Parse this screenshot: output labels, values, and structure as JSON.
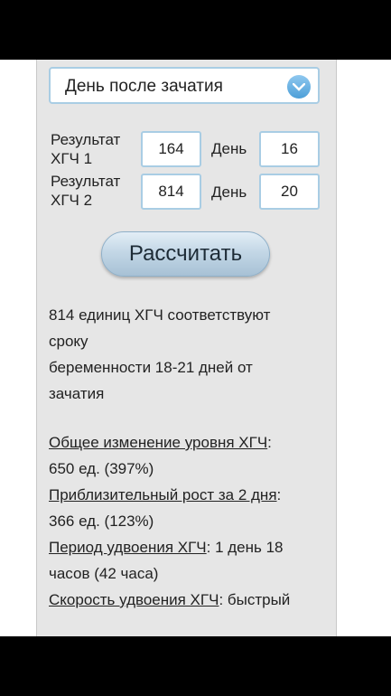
{
  "form": {
    "select_value": "День после зачатия",
    "rows": [
      {
        "label_line1": "Результат",
        "label_line2": "ХГЧ 1",
        "hcg": "164",
        "day_label": "День",
        "day": "16"
      },
      {
        "label_line1": "Результат",
        "label_line2": "ХГЧ 2",
        "hcg": "814",
        "day_label": "День",
        "day": "20"
      }
    ],
    "calculate_label": "Рассчитать"
  },
  "result": {
    "line1": "814 единиц ХГЧ соответствуют",
    "line2": "сроку",
    "line3": "беременности 18-21 дней от",
    "line4": "зачатия"
  },
  "stats": [
    {
      "label": "Общее изменение уровня ХГЧ",
      "value_a": ":",
      "value_b": "650 ед. (397%)"
    },
    {
      "label": "Приблизительный рост за 2 дня",
      "value_a": ":",
      "value_b": "366 ед. (123%)"
    },
    {
      "label": "Период удвоения ХГЧ",
      "value_a": ": 1 день 18",
      "value_b": "часов (42 часа)"
    },
    {
      "label": "Скорость удвоения ХГЧ",
      "value_a": ": быстрый",
      "value_b": ""
    }
  ],
  "colors": {
    "accent": "#4c9fd8",
    "panel": "#e6e6e6",
    "field_border": "#a9cde4"
  }
}
